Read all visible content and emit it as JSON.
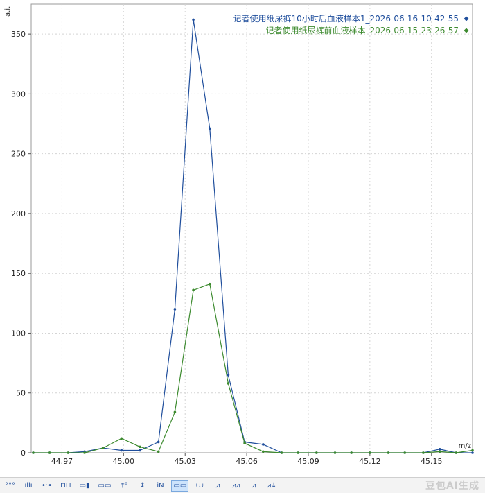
{
  "chart_data": {
    "type": "line",
    "title": "",
    "xlabel": "m/z",
    "ylabel": "a.i.",
    "xlim": [
      44.955,
      45.17
    ],
    "ylim": [
      0,
      375
    ],
    "x_ticks": [
      "44.97",
      "45.00",
      "45.03",
      "45.06",
      "45.09",
      "45.12",
      "45.15"
    ],
    "y_ticks": [
      "0",
      "50",
      "100",
      "150",
      "200",
      "250",
      "300",
      "350"
    ],
    "grid": true,
    "legend_position": "top-right",
    "series": [
      {
        "name": "记者使用纸尿裤10小时后血液样本1_2026-06-16-10-42-55",
        "color": "#1f4e9c",
        "points": [
          [
            44.956,
            0
          ],
          [
            44.964,
            0
          ],
          [
            44.973,
            0
          ],
          [
            44.981,
            1
          ],
          [
            44.99,
            4
          ],
          [
            44.999,
            2
          ],
          [
            45.008,
            2
          ],
          [
            45.017,
            9
          ],
          [
            45.025,
            120
          ],
          [
            45.034,
            362
          ],
          [
            45.042,
            271
          ],
          [
            45.051,
            65
          ],
          [
            45.059,
            9
          ],
          [
            45.068,
            7
          ],
          [
            45.077,
            0
          ],
          [
            45.085,
            0
          ],
          [
            45.094,
            0
          ],
          [
            45.103,
            0
          ],
          [
            45.111,
            0
          ],
          [
            45.12,
            0
          ],
          [
            45.129,
            0
          ],
          [
            45.137,
            0
          ],
          [
            45.146,
            0
          ],
          [
            45.154,
            3
          ],
          [
            45.162,
            0
          ],
          [
            45.17,
            0
          ]
        ]
      },
      {
        "name": "记者使用纸尿裤前血液样本_2026-06-15-23-26-57",
        "color": "#3c8a2e",
        "points": [
          [
            44.956,
            0
          ],
          [
            44.964,
            0
          ],
          [
            44.973,
            0
          ],
          [
            44.981,
            0
          ],
          [
            44.99,
            4
          ],
          [
            44.999,
            12
          ],
          [
            45.008,
            5
          ],
          [
            45.017,
            1
          ],
          [
            45.025,
            34
          ],
          [
            45.034,
            136
          ],
          [
            45.042,
            141
          ],
          [
            45.051,
            58
          ],
          [
            45.059,
            8
          ],
          [
            45.068,
            1
          ],
          [
            45.077,
            0
          ],
          [
            45.085,
            0
          ],
          [
            45.094,
            0
          ],
          [
            45.103,
            0
          ],
          [
            45.111,
            0
          ],
          [
            45.12,
            0
          ],
          [
            45.129,
            0
          ],
          [
            45.137,
            0
          ],
          [
            45.146,
            0
          ],
          [
            45.154,
            1
          ],
          [
            45.162,
            0
          ],
          [
            45.17,
            2
          ]
        ]
      }
    ]
  },
  "toolbar": {
    "buttons": [
      {
        "name": "tb-points-button",
        "label": "°°°"
      },
      {
        "name": "tb-bars-button",
        "label": "ıllı"
      },
      {
        "name": "tb-scatter-button",
        "label": "•·•"
      },
      {
        "name": "tb-peak-button",
        "label": "⊓⊔"
      },
      {
        "name": "tb-range-button",
        "label": "▭▮"
      },
      {
        "name": "tb-segments-button",
        "label": "▭▭"
      },
      {
        "name": "tb-cursor-button",
        "label": "†°"
      },
      {
        "name": "tb-vscale-button",
        "label": "↕"
      },
      {
        "name": "tb-step-button",
        "label": "ı̇N"
      },
      {
        "name": "tb-zoom-button",
        "label": "▭▭",
        "active": true
      },
      {
        "name": "tb-baseline-button",
        "label": "⩊"
      },
      {
        "name": "tb-peak-label-button",
        "label": "⩘"
      },
      {
        "name": "tb-peak-find-button",
        "label": "⩘⩘"
      },
      {
        "name": "tb-annotate-button",
        "label": "⩘"
      },
      {
        "name": "tb-export-button",
        "label": "⩘↓"
      }
    ]
  },
  "watermark": "豆包AI生成"
}
